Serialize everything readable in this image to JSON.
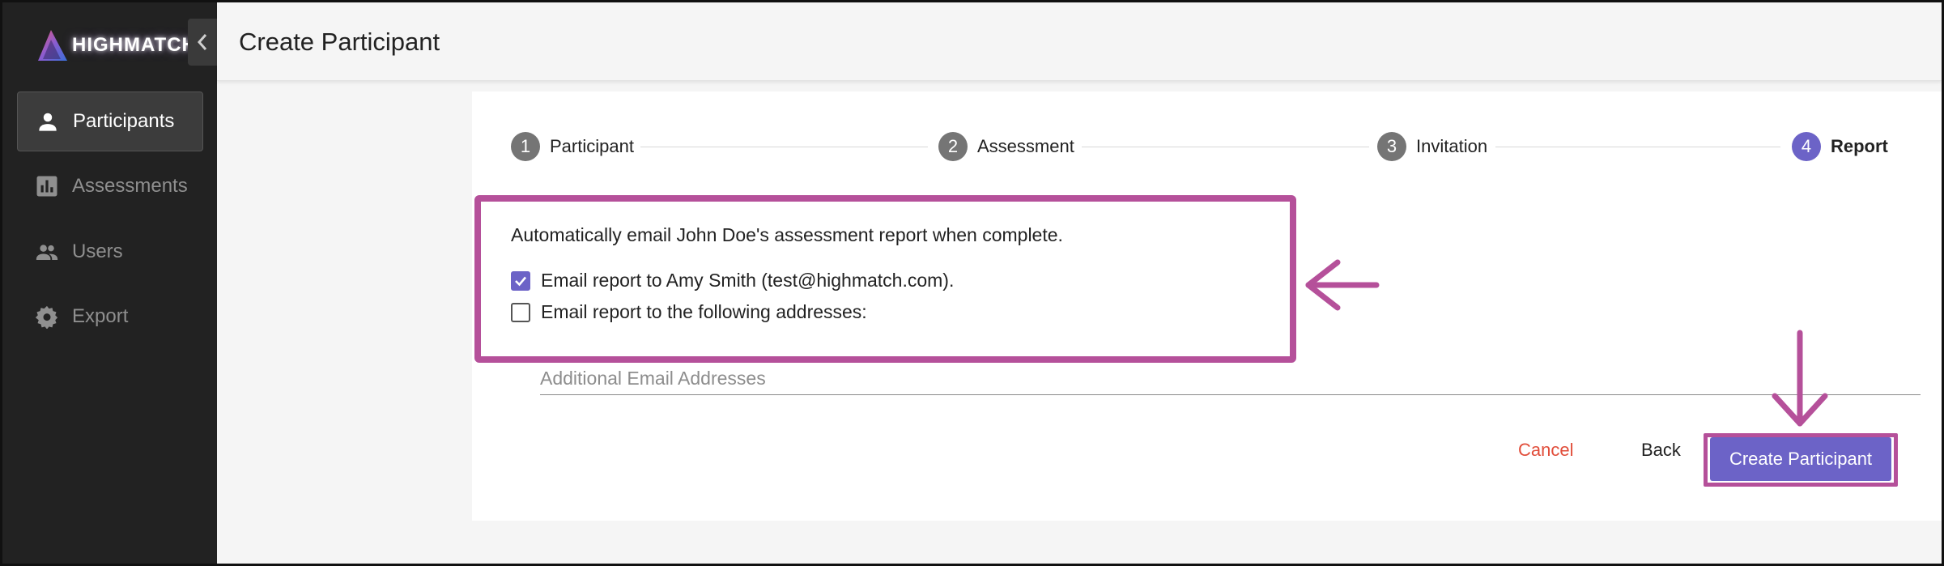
{
  "brand": {
    "name": "HIGHMATCH"
  },
  "sidebar": {
    "items": [
      {
        "label": "Participants",
        "icon": "person-icon",
        "active": true
      },
      {
        "label": "Assessments",
        "icon": "bar-chart-icon",
        "active": false
      },
      {
        "label": "Users",
        "icon": "group-icon",
        "active": false
      },
      {
        "label": "Export",
        "icon": "gear-icon",
        "active": false
      }
    ]
  },
  "header": {
    "title": "Create Participant"
  },
  "stepper": {
    "steps": [
      {
        "number": "1",
        "label": "Participant"
      },
      {
        "number": "2",
        "label": "Assessment"
      },
      {
        "number": "3",
        "label": "Invitation"
      },
      {
        "number": "4",
        "label": "Report"
      }
    ],
    "active_step": 4
  },
  "report": {
    "intro": "Automatically email John Doe's assessment report when complete.",
    "option_owner": {
      "label": "Email report to Amy Smith (test@highmatch.com).",
      "checked": true
    },
    "option_addresses": {
      "label": "Email report to the following addresses:",
      "checked": false
    },
    "email_input": {
      "value": "",
      "placeholder": "Additional Email Addresses"
    }
  },
  "actions": {
    "cancel_label": "Cancel",
    "back_label": "Back",
    "create_label": "Create Participant"
  },
  "colors": {
    "sidebar_bg": "#222222",
    "accent": "#6c63c7",
    "cancel": "#e14d3a",
    "annotation": "#b5509a"
  }
}
